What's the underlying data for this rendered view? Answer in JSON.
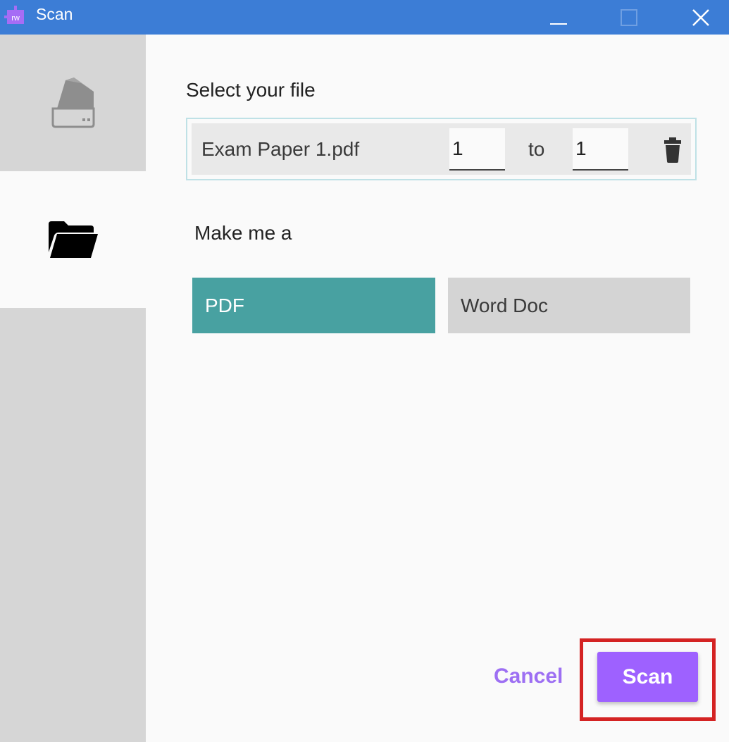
{
  "window": {
    "title": "Scan",
    "app_icon_text": "rw",
    "controls": {
      "minimize": "minimize-icon",
      "maximize": "maximize-icon",
      "close": "close-icon"
    }
  },
  "sidebar": {
    "items": [
      {
        "name": "scanner",
        "icon": "scanner-icon",
        "selected": false
      },
      {
        "name": "file",
        "icon": "folder-icon",
        "selected": true
      }
    ]
  },
  "main": {
    "select_label": "Select your file",
    "file": {
      "name": "Exam Paper 1.pdf",
      "from": "1",
      "to_label": "to",
      "to": "1",
      "delete_icon": "trash-icon"
    },
    "make_label": "Make me a",
    "formats": [
      {
        "label": "PDF",
        "selected": true
      },
      {
        "label": "Word Doc",
        "selected": false
      }
    ],
    "actions": {
      "cancel": "Cancel",
      "scan": "Scan"
    }
  },
  "colors": {
    "titlebar": "#3c7dd6",
    "selected_format": "#48a1a1",
    "accent": "#9e61ff",
    "highlight": "#d42323"
  }
}
